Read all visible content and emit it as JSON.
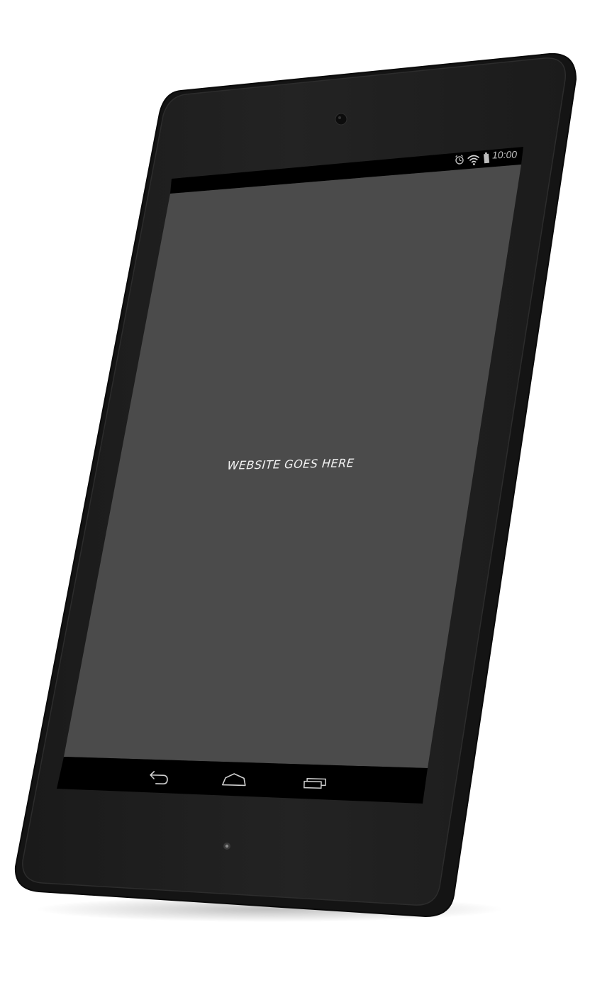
{
  "device": {
    "type": "tablet-mockup",
    "colors": {
      "body": "#1c1c1c",
      "bezel_edge": "#2a2a2a",
      "screen": "#4b4b4b",
      "bars": "#000000"
    }
  },
  "status_bar": {
    "icons": [
      "alarm-icon",
      "wifi-icon",
      "battery-icon"
    ],
    "time": "10:00"
  },
  "screen": {
    "placeholder_text": "WEBSITE GOES HERE"
  },
  "nav_bar": {
    "buttons": [
      "back-button",
      "home-button",
      "recents-button"
    ]
  }
}
